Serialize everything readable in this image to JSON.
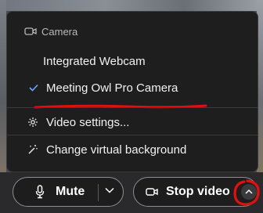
{
  "menu": {
    "section_header": "Camera",
    "items": [
      {
        "label": "Integrated Webcam",
        "selected": false
      },
      {
        "label": "Meeting Owl Pro Camera",
        "selected": true
      }
    ],
    "video_settings": "Video settings...",
    "virtual_background": "Change virtual background"
  },
  "controls": {
    "mute_label": "Mute",
    "stop_video_label": "Stop video"
  },
  "colors": {
    "menu_bg": "#1e1e1f",
    "check_accent": "#6aa7ff",
    "annotation_red": "#e01010"
  }
}
